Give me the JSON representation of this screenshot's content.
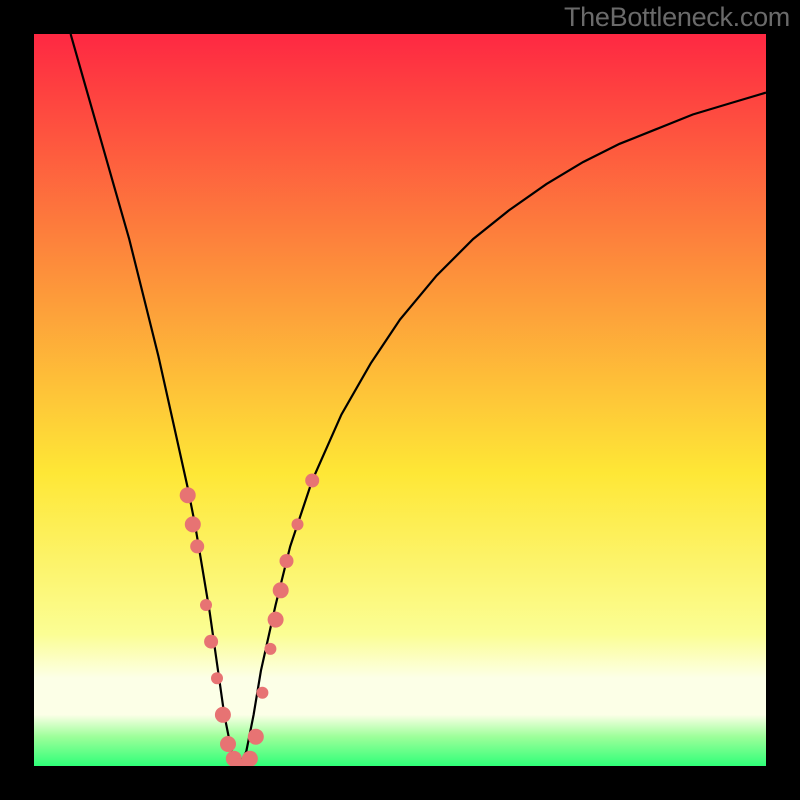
{
  "watermark": "TheBottleneck.com",
  "colors": {
    "frame": "#000000",
    "grad_top": "#fe2842",
    "grad_mid_upper": "#fd8e3b",
    "grad_mid": "#fee736",
    "grad_lower": "#fbfe94",
    "grad_band": "#fcffe7",
    "grad_bottom": "#2fff78",
    "curve": "#000000",
    "marker_fill": "#e77373",
    "marker_stroke": "#d55f5f"
  },
  "chart_data": {
    "type": "line",
    "title": "",
    "xlabel": "",
    "ylabel": "",
    "xlim": [
      0,
      100
    ],
    "ylim": [
      0,
      100
    ],
    "curve": {
      "name": "bottleneck-curve",
      "x": [
        5,
        7,
        9,
        11,
        13,
        15,
        17,
        19,
        21,
        22,
        23,
        24,
        25,
        26,
        27,
        28,
        29,
        30,
        31,
        33,
        35,
        38,
        42,
        46,
        50,
        55,
        60,
        65,
        70,
        75,
        80,
        85,
        90,
        95,
        100
      ],
      "y": [
        100,
        93,
        86,
        79,
        72,
        64,
        56,
        47,
        38,
        33,
        27,
        21,
        14,
        7,
        2,
        0,
        2,
        7,
        13,
        22,
        30,
        39,
        48,
        55,
        61,
        67,
        72,
        76,
        79.5,
        82.5,
        85,
        87,
        89,
        90.5,
        92
      ]
    },
    "markers": {
      "name": "data-points",
      "points": [
        {
          "x": 21.0,
          "y": 37,
          "r": 8
        },
        {
          "x": 21.7,
          "y": 33,
          "r": 8
        },
        {
          "x": 22.3,
          "y": 30,
          "r": 7
        },
        {
          "x": 23.5,
          "y": 22,
          "r": 6
        },
        {
          "x": 24.2,
          "y": 17,
          "r": 7
        },
        {
          "x": 25.0,
          "y": 12,
          "r": 6
        },
        {
          "x": 25.8,
          "y": 7,
          "r": 8
        },
        {
          "x": 26.5,
          "y": 3,
          "r": 8
        },
        {
          "x": 27.3,
          "y": 1,
          "r": 8
        },
        {
          "x": 28.0,
          "y": 0,
          "r": 8
        },
        {
          "x": 28.8,
          "y": 0,
          "r": 8
        },
        {
          "x": 29.5,
          "y": 1,
          "r": 8
        },
        {
          "x": 30.3,
          "y": 4,
          "r": 8
        },
        {
          "x": 31.2,
          "y": 10,
          "r": 6
        },
        {
          "x": 32.3,
          "y": 16,
          "r": 6
        },
        {
          "x": 33.0,
          "y": 20,
          "r": 8
        },
        {
          "x": 33.7,
          "y": 24,
          "r": 8
        },
        {
          "x": 34.5,
          "y": 28,
          "r": 7
        },
        {
          "x": 36.0,
          "y": 33,
          "r": 6
        },
        {
          "x": 38.0,
          "y": 39,
          "r": 7
        }
      ]
    }
  }
}
